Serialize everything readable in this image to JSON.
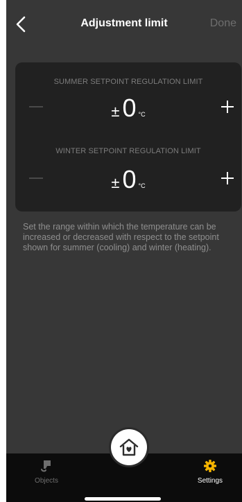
{
  "header": {
    "title": "Adjustment limit",
    "done_label": "Done"
  },
  "limits": {
    "summer": {
      "label": "SUMMER SETPOINT REGULATION LIMIT",
      "sign": "±",
      "value": "0",
      "unit": "°C"
    },
    "winter": {
      "label": "WINTER SETPOINT REGULATION LIMIT",
      "sign": "±",
      "value": "0",
      "unit": "°C"
    }
  },
  "description": "Set the range within which the temperature can be increased or decreased with respect to the setpoint shown for summer (cooling) and winter (heating).",
  "tabbar": {
    "objects_label": "Objects",
    "settings_label": "Settings"
  },
  "colors": {
    "background": "#373737",
    "card": "#212121",
    "accent": "#f5b400",
    "tabbar": "#0c0c0c"
  },
  "icons": {
    "back": "chevron-left-icon",
    "objects": "lamp-icon",
    "home": "house-heart-icon",
    "settings": "gear-icon"
  }
}
